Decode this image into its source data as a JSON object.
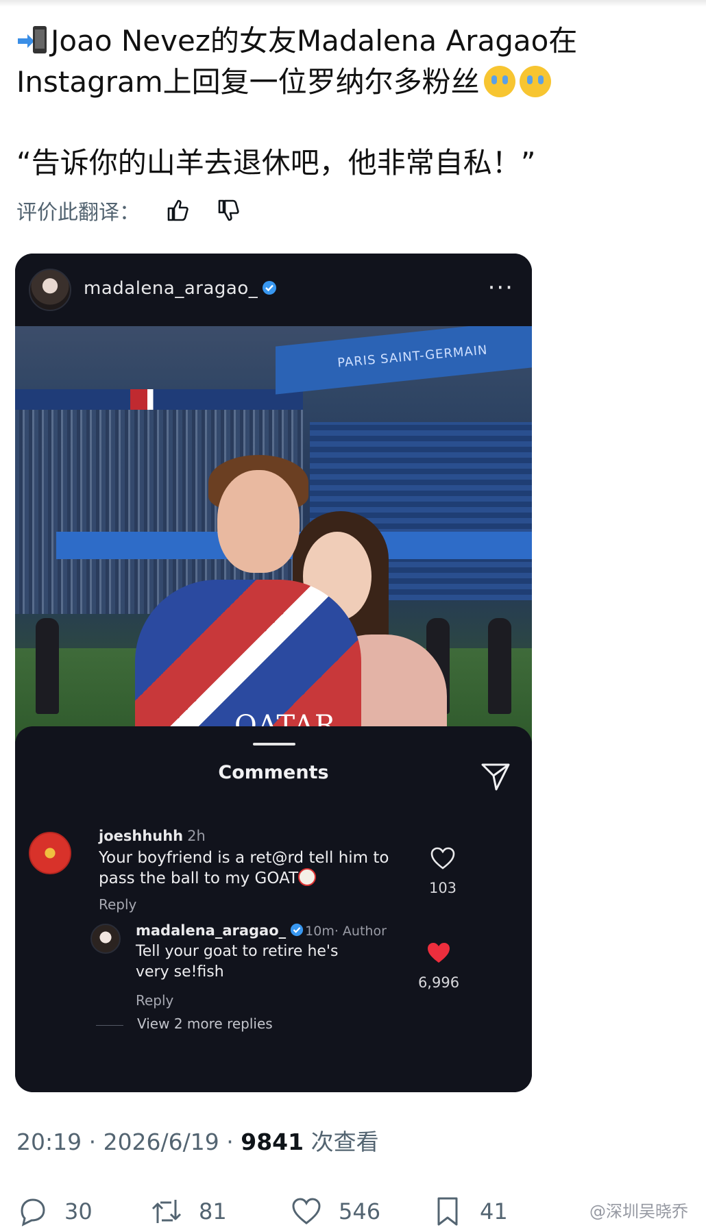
{
  "post": {
    "line1": "Joao Nevez的女友Madalena Aragao在",
    "line2": "Instagram上回复一位罗纳尔多粉丝",
    "quote": "“告诉你的山羊去退休吧，他非常自私！”",
    "rate_label": "评价此翻译："
  },
  "instagram": {
    "username": "madalena_aragao_",
    "stadium_sign": "PARIS SAINT-GERMAIN",
    "jersey_text": "QATAR",
    "sheet_title": "Comments",
    "comment": {
      "user": "joeshhuhh",
      "time": "2h",
      "text": "Your boyfriend is a ret@rd tell him to pass the ball to my GOAT",
      "reply_label": "Reply",
      "likes": "103"
    },
    "reply": {
      "user": "madalena_aragao_",
      "meta": "10m· Author",
      "text": "Tell your goat to retire he's very se!fish",
      "reply_label": "Reply",
      "likes": "6,996",
      "view_more": "View 2 more replies"
    }
  },
  "meta": {
    "time": "20:19 · 2026/6/19 · ",
    "views": "9841",
    "views_label": " 次查看"
  },
  "actions": {
    "replies": "30",
    "reposts": "81",
    "likes": "546",
    "bookmarks": "41"
  },
  "watermark": "@深圳吴晓乔",
  "colors": {
    "ig_background": "#11131c",
    "verified_blue": "#3897f0",
    "heart_red": "#ed2e3d",
    "muted_gray": "#536471"
  }
}
